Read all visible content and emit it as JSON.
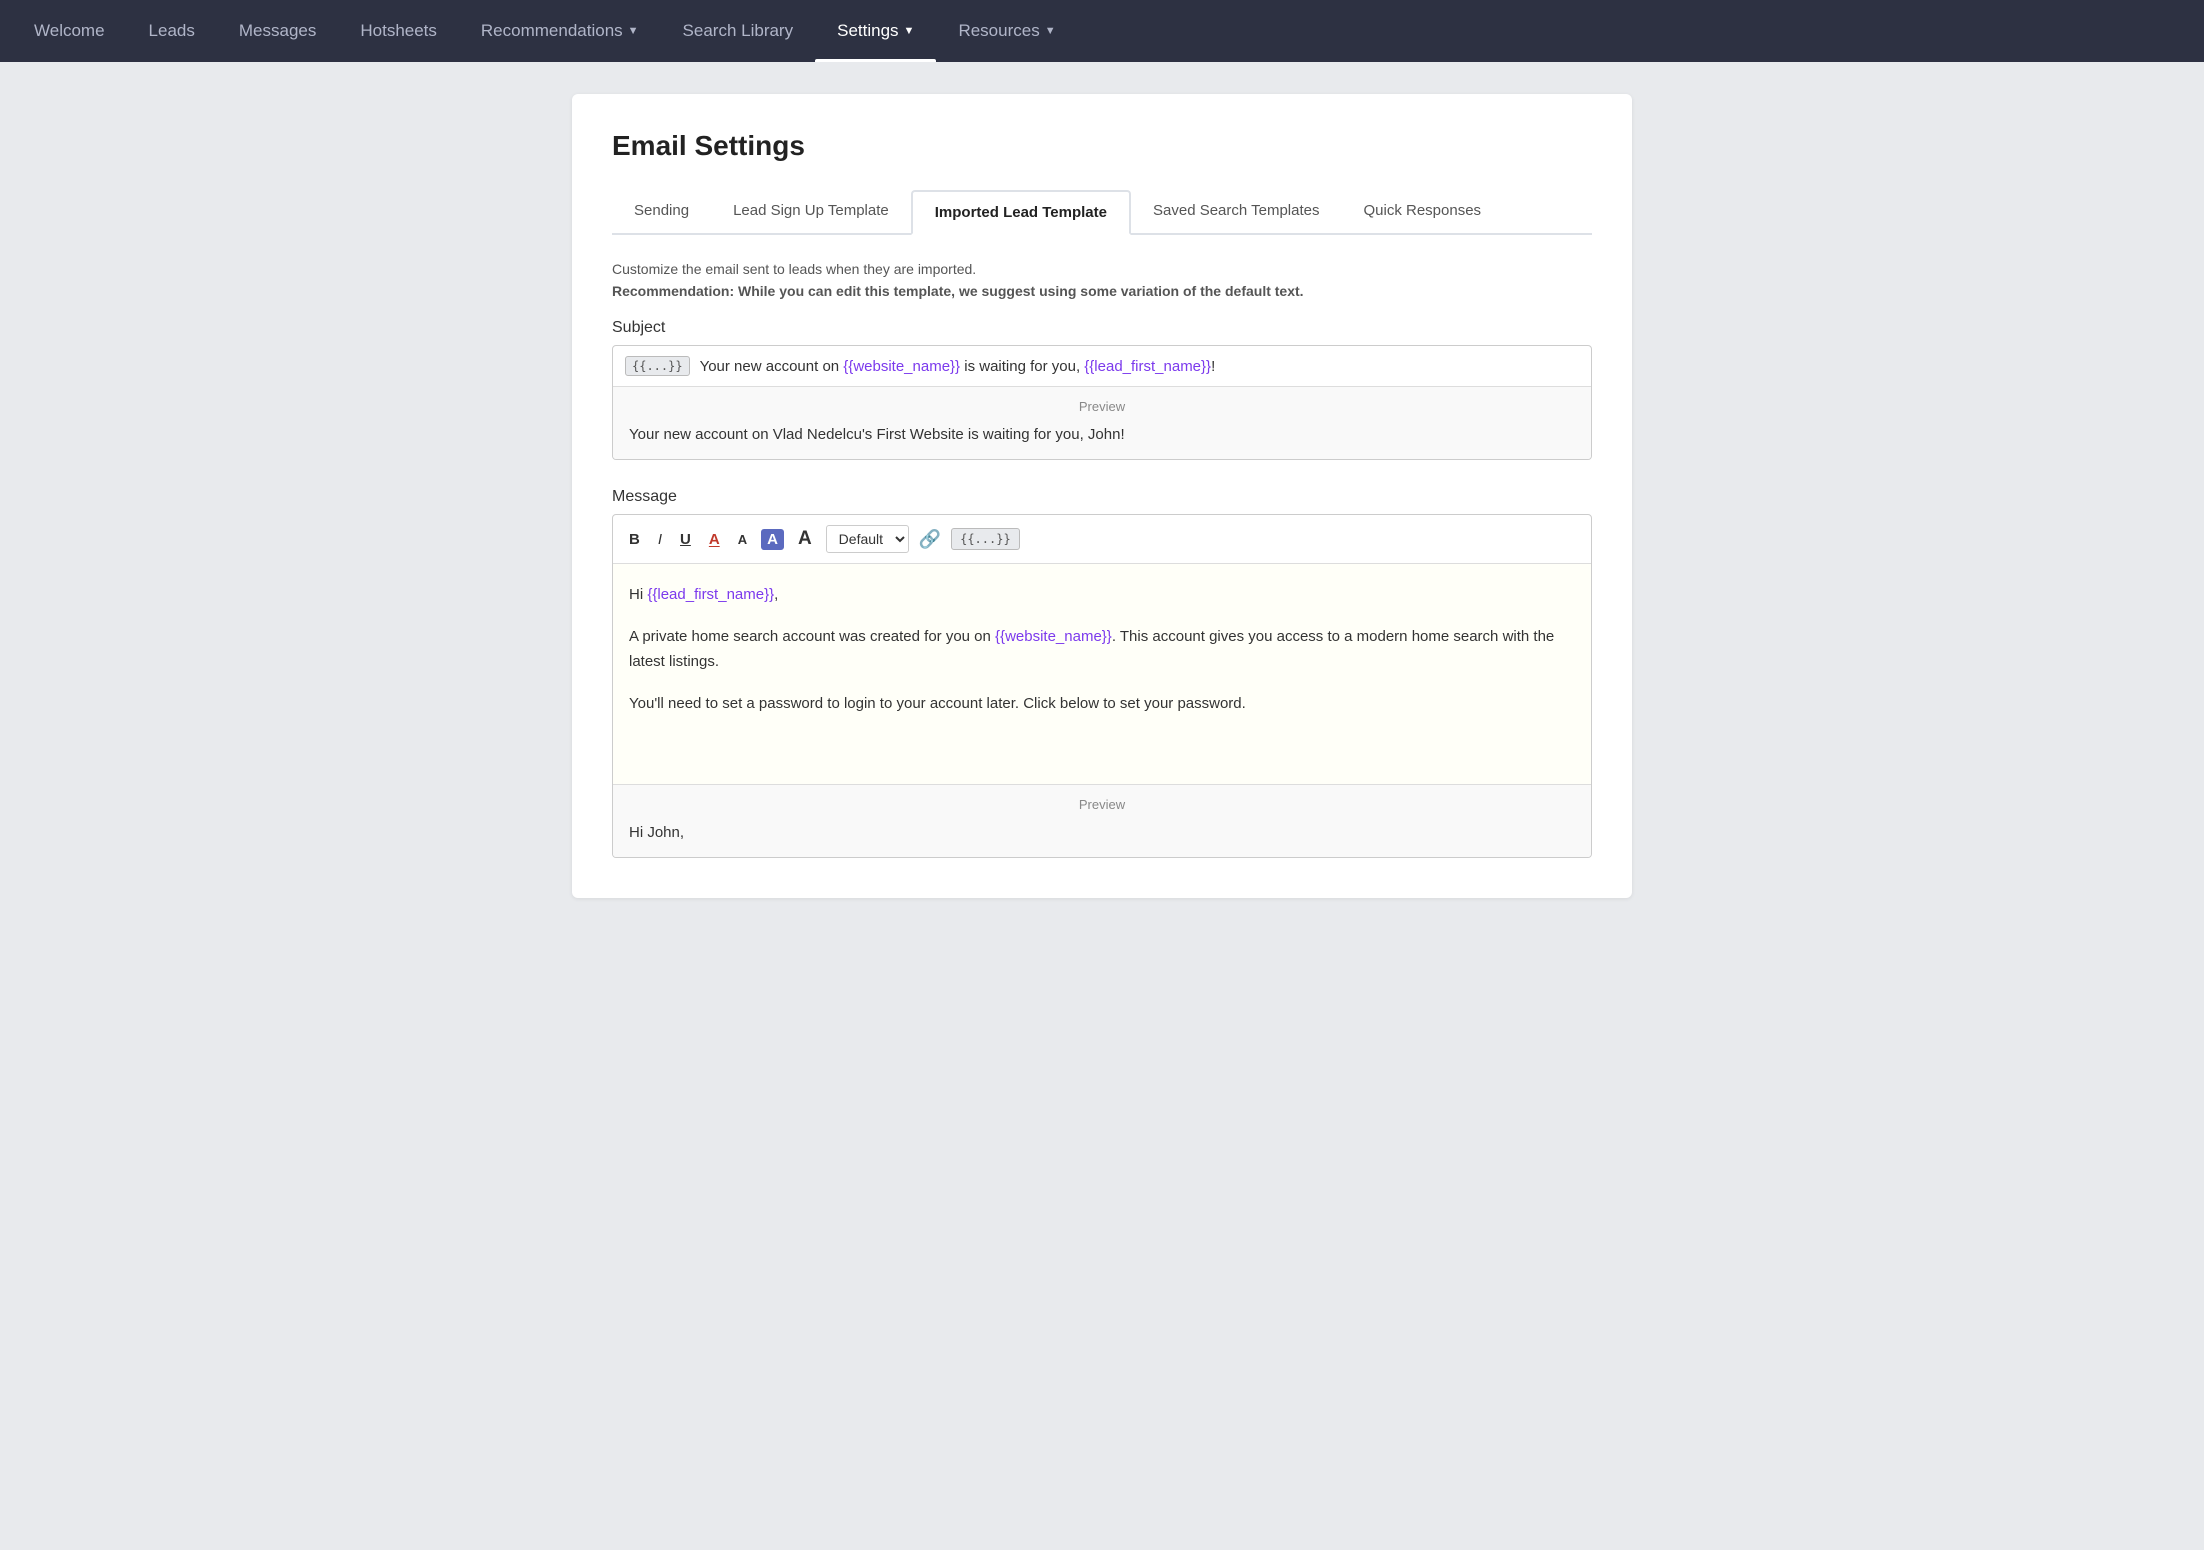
{
  "nav": {
    "items": [
      {
        "label": "Welcome",
        "active": false
      },
      {
        "label": "Leads",
        "active": false
      },
      {
        "label": "Messages",
        "active": false
      },
      {
        "label": "Hotsheets",
        "active": false
      },
      {
        "label": "Recommendations",
        "active": false,
        "hasChevron": true
      },
      {
        "label": "Search Library",
        "active": false
      },
      {
        "label": "Settings",
        "active": true,
        "hasChevron": true
      },
      {
        "label": "Resources",
        "active": false,
        "hasChevron": true
      }
    ]
  },
  "page": {
    "title": "Email Settings",
    "tabs": [
      {
        "label": "Sending",
        "active": false
      },
      {
        "label": "Lead Sign Up Template",
        "active": false
      },
      {
        "label": "Imported Lead Template",
        "active": true
      },
      {
        "label": "Saved Search Templates",
        "active": false
      },
      {
        "label": "Quick Responses",
        "active": false
      }
    ],
    "description_normal": "Customize the email sent to leads when they are imported.",
    "description_bold": "Recommendation: While you can edit this template, we suggest using some variation of the default text.",
    "subject_label": "Subject",
    "subject_badge": "{{...}}",
    "subject_text_before": "Your new account on ",
    "subject_var1": "{{website_name}}",
    "subject_text_mid": " is waiting for you, ",
    "subject_var2": "{{lead_first_name}}",
    "subject_text_end": "!",
    "preview_label": "Preview",
    "subject_preview": "Your new account on Vlad Nedelcu's First Website is waiting for you, John!",
    "message_label": "Message",
    "font_options": [
      "Default"
    ],
    "font_selected": "Default",
    "toolbar": {
      "bold": "B",
      "italic": "I",
      "underline": "U",
      "color_a": "A",
      "small_a": "A",
      "highlight_a": "A",
      "large_a": "A",
      "link_icon": "🔗",
      "template_btn": "{{...}}"
    },
    "message_hi": "Hi ",
    "message_var1": "{{lead_first_name}}",
    "message_comma": ",",
    "message_para2": "A private home search account was created for you on ",
    "message_var2": "{{website_name}}",
    "message_para2_end": ". This account gives you access to a modern home search with the latest listings.",
    "message_para3": "You'll need to set a password to login to your account later. Click below to set your password.",
    "preview_label2": "Preview",
    "preview_hi": "Hi John,"
  }
}
